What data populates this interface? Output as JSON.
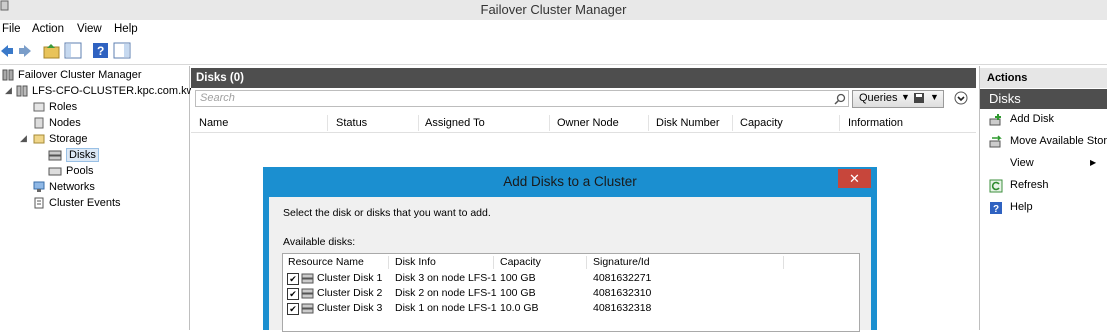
{
  "window": {
    "title": "Failover Cluster Manager"
  },
  "menu": [
    "File",
    "Action",
    "View",
    "Help"
  ],
  "tree": {
    "root": "Failover Cluster Manager",
    "cluster": "LFS-CFO-CLUSTER.kpc.com.kw",
    "roles": "Roles",
    "nodes": "Nodes",
    "storage": "Storage",
    "disks": "Disks",
    "pools": "Pools",
    "networks": "Networks",
    "events": "Cluster Events"
  },
  "center": {
    "header": "Disks (0)",
    "search_placeholder": "Search",
    "queries_label": "Queries",
    "columns": [
      "Name",
      "Status",
      "Assigned To",
      "Owner Node",
      "Disk Number",
      "Capacity",
      "Information"
    ]
  },
  "actions": {
    "header": "Actions",
    "section": "Disks",
    "items": [
      "Add Disk",
      "Move Available Stora",
      "View",
      "Refresh",
      "Help"
    ]
  },
  "dialog": {
    "title": "Add Disks to a Cluster",
    "instruction": "Select the disk or disks that you want to add.",
    "available_label": "Available disks:",
    "columns": [
      "Resource Name",
      "Disk Info",
      "Capacity",
      "Signature/Id"
    ],
    "rows": [
      {
        "name": "Cluster Disk 1",
        "info": "Disk 3 on node LFS-1",
        "capacity": "100 GB",
        "signature": "4081632271",
        "checked": true
      },
      {
        "name": "Cluster Disk 2",
        "info": "Disk 2 on node LFS-1",
        "capacity": "100 GB",
        "signature": "4081632310",
        "checked": true
      },
      {
        "name": "Cluster Disk 3",
        "info": "Disk 1 on node LFS-1",
        "capacity": "10.0 GB",
        "signature": "4081632318",
        "checked": true
      }
    ]
  },
  "colors": {
    "accent": "#1b8fd0",
    "header_dark": "#4e4e4e",
    "close_red": "#c7463b"
  }
}
